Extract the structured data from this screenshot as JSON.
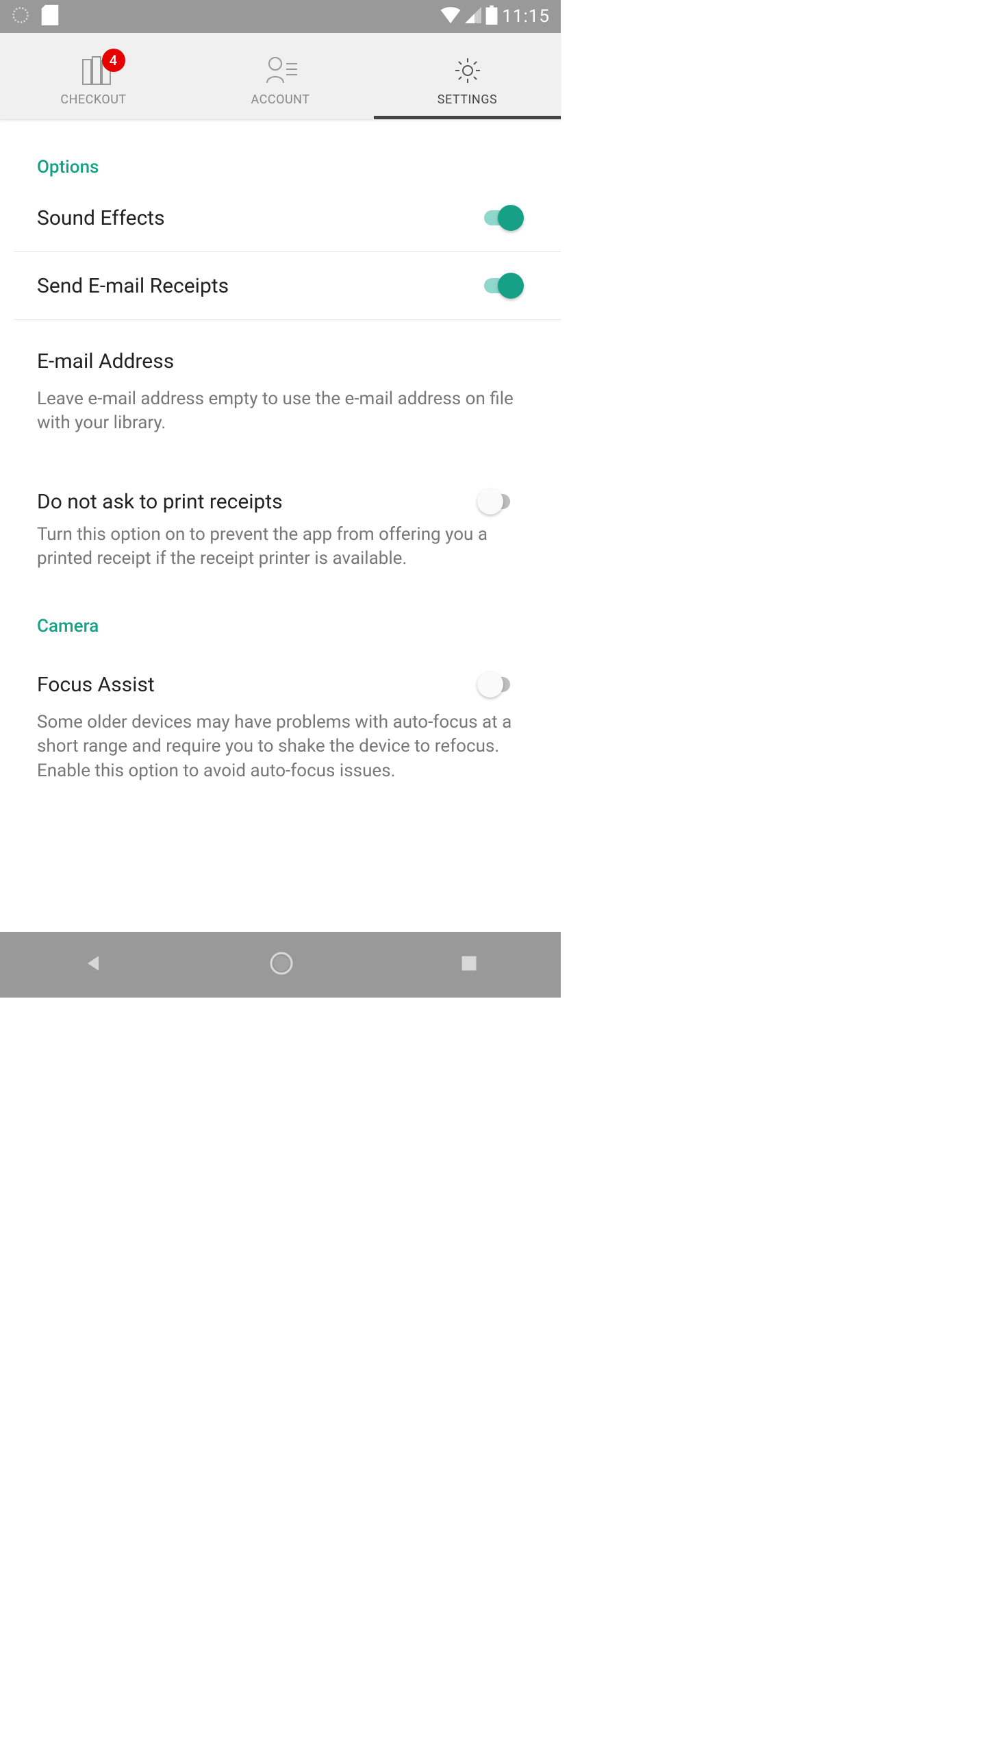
{
  "statusbar": {
    "time": "11:15"
  },
  "tabs": {
    "checkout": {
      "label": "CHECKOUT",
      "badge": "4"
    },
    "account": {
      "label": "ACCOUNT"
    },
    "settings": {
      "label": "SETTINGS"
    }
  },
  "sections": {
    "options": {
      "title": "Options",
      "sound_effects": {
        "label": "Sound Effects",
        "value": true
      },
      "send_email": {
        "label": "Send E-mail Receipts",
        "value": true
      },
      "email_address": {
        "label": "E-mail Address",
        "hint": "Leave e-mail address empty to use the e-mail address on file with your library."
      },
      "no_print": {
        "label": "Do not ask to print receipts",
        "value": false,
        "hint": "Turn this option on to prevent the app from offering you a printed receipt if the receipt printer is available."
      }
    },
    "camera": {
      "title": "Camera",
      "focus_assist": {
        "label": "Focus Assist",
        "value": false,
        "hint": "Some older devices may have problems with auto-focus at a short range and require you to shake the device to refocus. Enable this option to avoid auto-focus issues."
      }
    }
  }
}
